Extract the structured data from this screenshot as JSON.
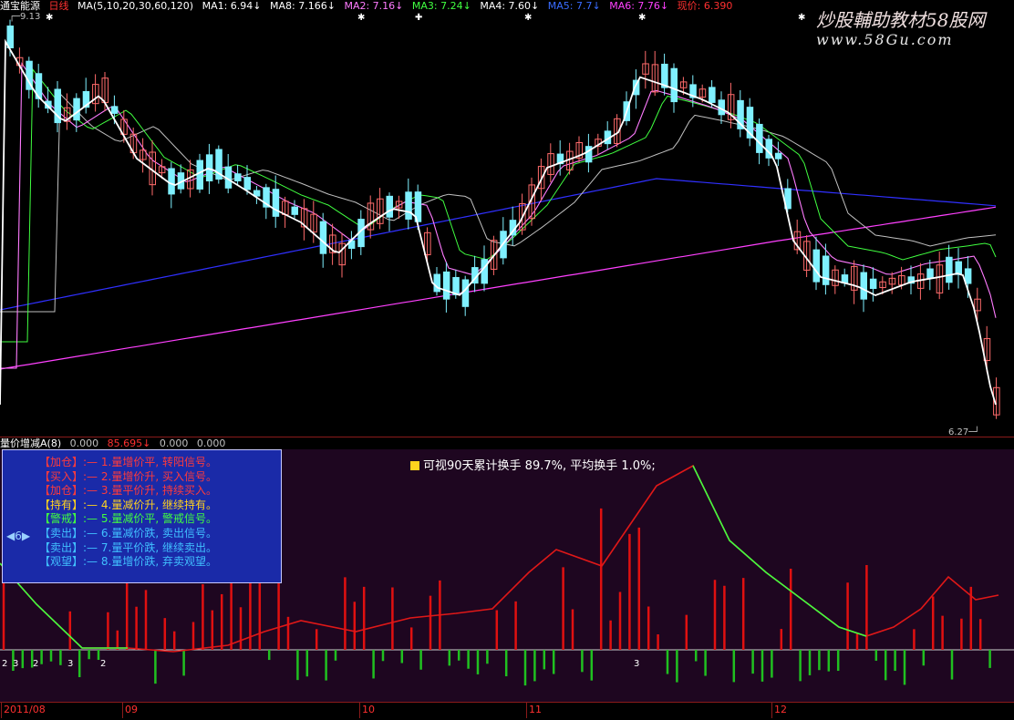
{
  "header": {
    "stock_name": "通宝能源",
    "period": "日线",
    "ma_params": "MA(5,10,20,30,60,120)",
    "ma1": "MA1: 6.94↓",
    "ma8": "MA8: 7.166↓",
    "ma2": "MA2: 7.16↓",
    "ma3": "MA3: 7.24↓",
    "ma4": "MA4: 7.60↓",
    "ma5": "MA5: 7.7↓",
    "ma6": "MA6: 7.76↓",
    "current_price": "现价: 6.390"
  },
  "watermark": {
    "title": "炒股輔助教材58股网",
    "url": "www.58Gu.com"
  },
  "price_labels": {
    "high": "9.13",
    "low": "6.27"
  },
  "sub_header": {
    "indicator": "量价增减A(8)",
    "v1": "0.000",
    "v2": "85.695↓",
    "v3": "0.000",
    "v4": "0.000"
  },
  "legend": {
    "nav": "◀6▶",
    "rows": [
      {
        "tag": "【加仓】",
        "code": ":—",
        "text": "1.量增价平, 转阳信号。",
        "color": "#ff3b3b"
      },
      {
        "tag": "【买入】",
        "code": ":—",
        "text": "2.量增价升, 买入信号。",
        "color": "#ff3b3b"
      },
      {
        "tag": "【加仓】",
        "code": ":—",
        "text": "3.量平价升, 持续买入。",
        "color": "#ff3b3b"
      },
      {
        "tag": "【持有】",
        "code": ":—",
        "text": "4.量减价升, 继续持有。",
        "color": "#ffd21e"
      },
      {
        "tag": "【警戒】",
        "code": ":—",
        "text": "5.量减价平, 警戒信号。",
        "color": "#40ff40"
      },
      {
        "tag": "【卖出】",
        "code": ":—",
        "text": "6.量减价跌, 卖出信号。",
        "color": "#40c0ff"
      },
      {
        "tag": "【卖出】",
        "code": ":—",
        "text": "7.量平价跌, 继续卖出。",
        "color": "#40c0ff"
      },
      {
        "tag": "【观望】",
        "code": ":—",
        "text": "8.量增价跌, 弃卖观望。",
        "color": "#40c0ff"
      }
    ]
  },
  "turnover_note": "可视90天累计换手 89.7%,  平均换手 1.0%;",
  "date_axis": [
    {
      "label": "2011/08"
    },
    {
      "label": "09"
    },
    {
      "label": "10"
    },
    {
      "label": "11"
    },
    {
      "label": "12"
    }
  ],
  "signal_digits": [
    "2",
    "3",
    "2",
    "3",
    "2",
    "3"
  ],
  "colors": {
    "up": "#ff6b6b",
    "down": "#7ff0ff",
    "ma1": "#ffffff",
    "ma2": "#ff7bff",
    "ma3": "#40ff40",
    "ma4": "#c0c0c0",
    "ma5": "#3030ff",
    "ma6": "#ff40ff"
  }
}
